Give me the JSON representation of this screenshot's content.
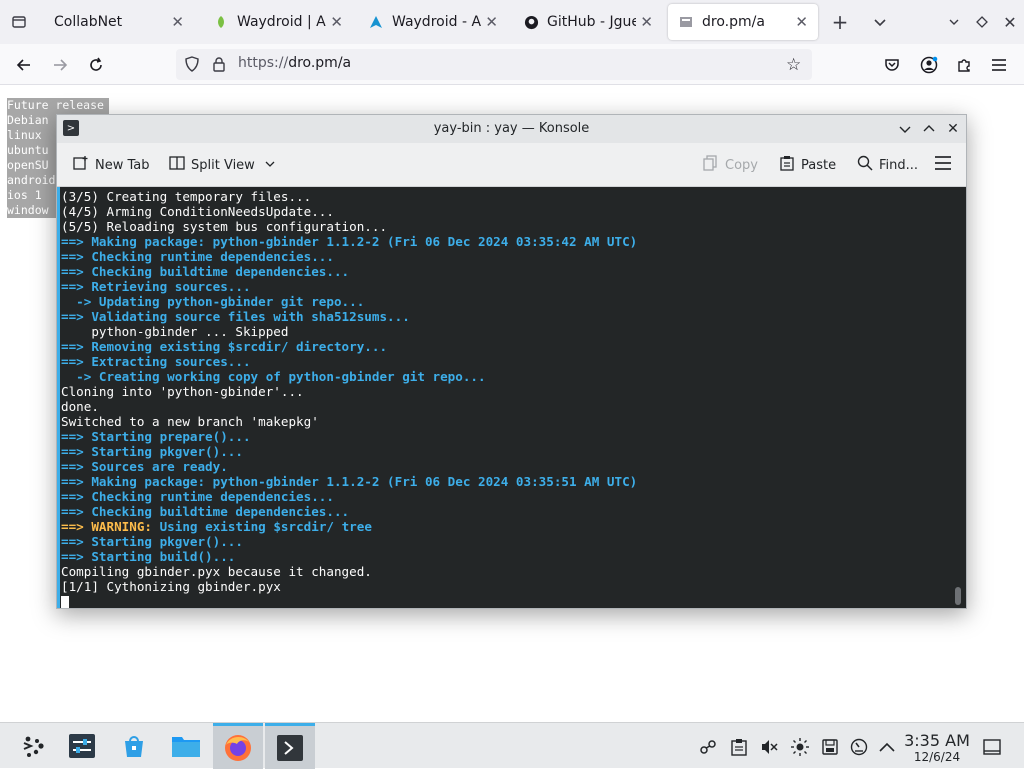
{
  "browser": {
    "tabs": [
      {
        "title": "CollabNet",
        "favicon": "collabnet-favicon",
        "active": false
      },
      {
        "title": "Waydroid | And",
        "favicon": "waydroid-favicon",
        "active": false
      },
      {
        "title": "Waydroid - Arch",
        "favicon": "arch-linux-favicon",
        "active": false
      },
      {
        "title": "GitHub - Jguer/",
        "favicon": "github-favicon",
        "active": false
      },
      {
        "title": "dro.pm/a",
        "favicon": "page-favicon",
        "active": true
      }
    ],
    "url_scheme": "https://",
    "url_host": "dro.pm/a"
  },
  "page_behind": {
    "lines": [
      "Future release",
      "Debian",
      "linux",
      "ubuntu",
      "openSU",
      "android",
      "ios 1",
      "window"
    ]
  },
  "konsole": {
    "title": "yay-bin : yay — Konsole",
    "toolbar": {
      "new_tab": "New Tab",
      "split_view": "Split View",
      "copy": "Copy",
      "paste": "Paste",
      "find": "Find..."
    },
    "terminal_lines": [
      [
        {
          "t": "(3/5) Creating temporary files...",
          "c": ""
        }
      ],
      [
        {
          "t": "(4/5) Arming ConditionNeedsUpdate...",
          "c": ""
        }
      ],
      [
        {
          "t": "(5/5) Reloading system bus configuration...",
          "c": ""
        }
      ],
      [
        {
          "t": "==> Making package: python-gbinder 1.1.2-2 (Fri 06 Dec 2024 03:35:42 AM UTC)",
          "c": "c-blue"
        }
      ],
      [
        {
          "t": "==> Checking runtime dependencies...",
          "c": "c-blue"
        }
      ],
      [
        {
          "t": "==> Checking buildtime dependencies...",
          "c": "c-blue"
        }
      ],
      [
        {
          "t": "==> Retrieving sources...",
          "c": "c-blue"
        }
      ],
      [
        {
          "t": "  -> Updating python-gbinder git repo...",
          "c": "c-blue"
        }
      ],
      [
        {
          "t": "==> Validating source files with sha512sums...",
          "c": "c-blue"
        }
      ],
      [
        {
          "t": "    python-gbinder ... Skipped",
          "c": ""
        }
      ],
      [
        {
          "t": "==> Removing existing $srcdir/ directory...",
          "c": "c-blue"
        }
      ],
      [
        {
          "t": "==> Extracting sources...",
          "c": "c-blue"
        }
      ],
      [
        {
          "t": "  -> Creating working copy of python-gbinder git repo...",
          "c": "c-blue"
        }
      ],
      [
        {
          "t": "Cloning into 'python-gbinder'...",
          "c": ""
        }
      ],
      [
        {
          "t": "done.",
          "c": ""
        }
      ],
      [
        {
          "t": "Switched to a new branch 'makepkg'",
          "c": ""
        }
      ],
      [
        {
          "t": "==> Starting prepare()...",
          "c": "c-blue"
        }
      ],
      [
        {
          "t": "==> Starting pkgver()...",
          "c": "c-blue"
        }
      ],
      [
        {
          "t": "==> Sources are ready.",
          "c": "c-blue"
        }
      ],
      [
        {
          "t": "==> Making package: python-gbinder 1.1.2-2 (Fri 06 Dec 2024 03:35:51 AM UTC)",
          "c": "c-blue"
        }
      ],
      [
        {
          "t": "==> Checking runtime dependencies...",
          "c": "c-blue"
        }
      ],
      [
        {
          "t": "==> Checking buildtime dependencies...",
          "c": "c-blue"
        }
      ],
      [
        {
          "t": "==> ",
          "c": "c-yellow"
        },
        {
          "t": "WARNING:",
          "c": "c-yellow"
        },
        {
          "t": " Using existing $srcdir/ tree",
          "c": "c-blue"
        }
      ],
      [
        {
          "t": "==> Starting pkgver()...",
          "c": "c-blue"
        }
      ],
      [
        {
          "t": "==> Starting build()...",
          "c": "c-blue"
        }
      ],
      [
        {
          "t": "Compiling gbinder.pyx because it changed.",
          "c": ""
        }
      ],
      [
        {
          "t": "[1/1] Cythonizing gbinder.pyx",
          "c": ""
        }
      ]
    ]
  },
  "taskbar": {
    "apps": [
      "application-launcher-icon",
      "system-settings-icon",
      "discover-store-icon",
      "dolphin-files-icon",
      "firefox-icon",
      "konsole-icon"
    ],
    "clock_time": "3:35 AM",
    "clock_date": "12/6/24"
  },
  "colors": {
    "terminal_bg": "#232627",
    "accent": "#3daee9",
    "warning": "#fdbc4b"
  }
}
